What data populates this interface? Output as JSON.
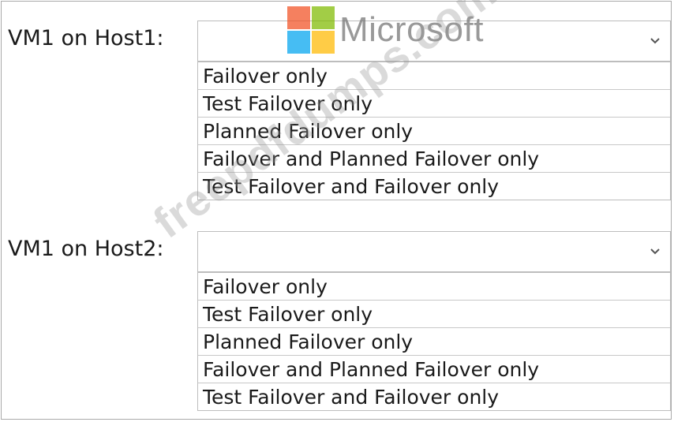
{
  "questions": [
    {
      "label": "VM1 on Host1:",
      "selected": "",
      "options": [
        "Failover only",
        "Test Failover only",
        "Planned Failover only",
        "Failover and Planned Failover only",
        "Test Failover and Failover only"
      ]
    },
    {
      "label": "VM1 on Host2:",
      "selected": "",
      "options": [
        "Failover only",
        "Test Failover only",
        "Planned Failover only",
        "Failover and Planned Failover only",
        "Test Failover and Failover only"
      ]
    }
  ],
  "logo": {
    "text": "Microsoft",
    "icon": "microsoft-logo-icon",
    "colors": [
      "#f25022",
      "#7fba00",
      "#00a4ef",
      "#ffb900"
    ]
  },
  "watermark": {
    "text": "freepdfdumps.com"
  },
  "icons": {
    "dropdown": "chevron-down-icon"
  }
}
